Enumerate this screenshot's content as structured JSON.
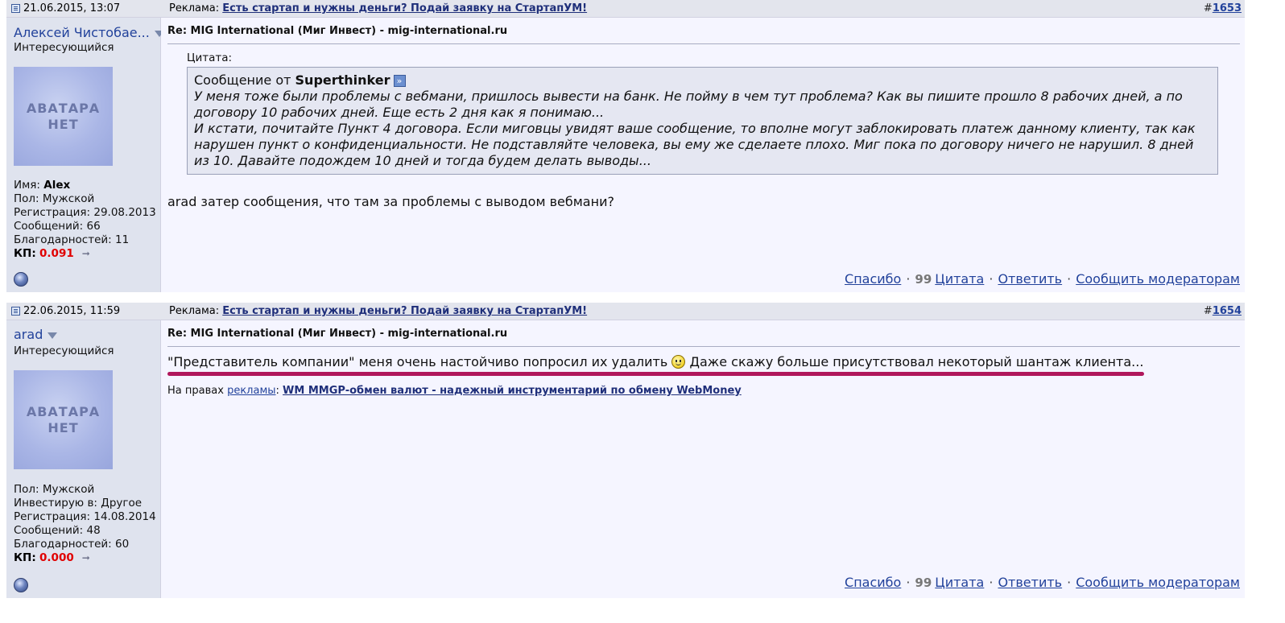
{
  "posts": [
    {
      "date": "21.06.2015, 13:07",
      "ad_prefix": "Реклама:",
      "ad_link": "Есть стартап и нужны деньги? Подай заявку на СтартапУМ!",
      "post_hash": "#",
      "post_number": "1653",
      "user": {
        "name": "Алексей Чистобае...",
        "title": "Интересующийся",
        "avatar_line1": "АВАТАРА",
        "avatar_line2": "НЕТ",
        "stats": [
          {
            "label": "Имя:",
            "value": "Alex"
          },
          {
            "label": "Пол:",
            "value": "Мужской"
          },
          {
            "label": "Регистрация:",
            "value": "29.08.2013"
          },
          {
            "label": "Сообщений:",
            "value": "66"
          },
          {
            "label": "Благодарностей:",
            "value": "11"
          }
        ],
        "kp_label": "КП:",
        "kp_value": "0.091"
      },
      "title": "Re: MIG International (Миг Инвест) - mig-international.ru",
      "quote_label": "Цитата:",
      "quote_from_prefix": "Сообщение от",
      "quote_author": "Superthinker",
      "quote_lines": [
        "У меня тоже были проблемы с вебмани, пришлось вывести на банк. Не пойму в чем тут проблема? Как вы пишите прошло 8 рабочих дней, а по",
        "договору 10 рабочих дней. Еще есть 2 дня как я понимаю...",
        "И кстати, почитайте Пункт 4 договора. Если миговцы увидят ваше сообщение, то вполне могут заблокировать платеж данному клиенту, так как",
        "нарушен пункт о конфиденциальности. Не подставляйте человека, вы ему же сделаете плохо. Миг пока по договору ничего не нарушил. 8 дней",
        "из 10. Давайте подождем 10 дней и тогда будем делать выводы..."
      ],
      "message": "arad затер сообщения, что там за проблемы с выводом вебмани?",
      "actions": {
        "thanks": "Спасибо",
        "quote": "Цитата",
        "reply": "Ответить",
        "report": "Сообщить модераторам",
        "dot": "·"
      }
    },
    {
      "date": "22.06.2015, 11:59",
      "ad_prefix": "Реклама:",
      "ad_link": "Есть стартап и нужны деньги? Подай заявку на СтартапУМ!",
      "post_hash": "#",
      "post_number": "1654",
      "user": {
        "name": "arad",
        "title": "Интересующийся",
        "avatar_line1": "АВАТАРА",
        "avatar_line2": "НЕТ",
        "stats": [
          {
            "label": "Пол:",
            "value": "Мужской"
          },
          {
            "label": "Инвестирую в:",
            "value": "Другое"
          },
          {
            "label": "Регистрация:",
            "value": "14.08.2014"
          },
          {
            "label": "Сообщений:",
            "value": "48"
          },
          {
            "label": "Благодарностей:",
            "value": "60"
          }
        ],
        "kp_label": "КП:",
        "kp_value": "0.000"
      },
      "title": "Re: MIG International (Миг Инвест) - mig-international.ru",
      "message_part1": "\"Представитель компании\" меня очень настойчиво попросил их удалить",
      "message_part2": "Даже скажу больше присутствовал некоторый шантаж клиента...",
      "ad_rights_prefix": "На правах",
      "ad_rights_link": "рекламы",
      "ad_rights_colon": ":",
      "ad_rights_text": "WM MMGP-обмен валют - надежный инструментарий по обмену WebMoney",
      "actions": {
        "thanks": "Спасибо",
        "quote": "Цитата",
        "reply": "Ответить",
        "report": "Сообщить модераторам",
        "dot": "·"
      }
    }
  ],
  "colors": {
    "link": "#22429b",
    "kp_value": "#e00000",
    "underline_mark": "#b0175c"
  }
}
